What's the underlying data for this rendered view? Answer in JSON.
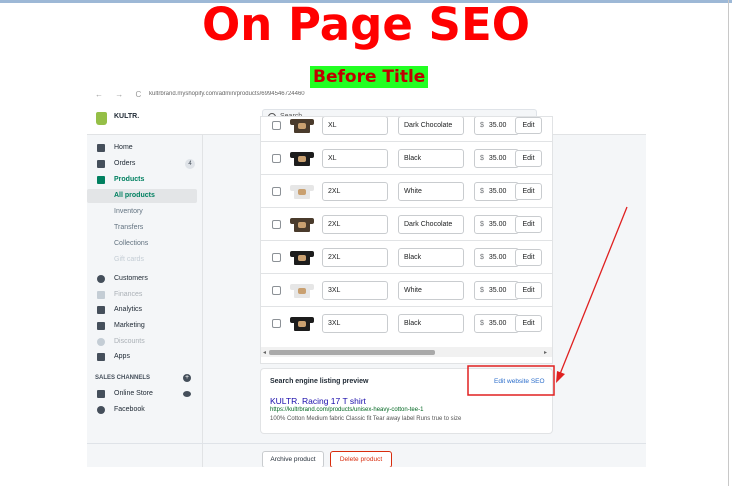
{
  "slide": {
    "title": "On Page SEO",
    "badge": "Before Title"
  },
  "browser": {
    "nav_glyphs": "← → C",
    "url": "kultrbrand.myshopify.com/admin/products/6994546724460"
  },
  "topbar": {
    "brand": "KULTR.",
    "search_placeholder": "Search"
  },
  "sidebar": {
    "items": [
      {
        "label": "Home",
        "icon": "home-icon"
      },
      {
        "label": "Orders",
        "icon": "orders-icon",
        "badge": "4"
      },
      {
        "label": "Products",
        "icon": "tag-icon"
      },
      {
        "label": "All products"
      },
      {
        "label": "Inventory"
      },
      {
        "label": "Transfers"
      },
      {
        "label": "Collections"
      },
      {
        "label": "Gift cards"
      },
      {
        "label": "Customers",
        "icon": "person-icon"
      },
      {
        "label": "Finances",
        "icon": "finances-icon"
      },
      {
        "label": "Analytics",
        "icon": "bar-chart-icon"
      },
      {
        "label": "Marketing",
        "icon": "megaphone-icon"
      },
      {
        "label": "Discounts",
        "icon": "discount-icon"
      },
      {
        "label": "Apps",
        "icon": "apps-icon"
      }
    ],
    "sales_channels_heading": "SALES CHANNELS",
    "channels": [
      {
        "label": "Online Store",
        "icon": "store-icon"
      },
      {
        "label": "Facebook",
        "icon": "facebook-icon"
      }
    ]
  },
  "variants": {
    "currency": "$",
    "edit_label": "Edit",
    "rows": [
      {
        "size": "XL",
        "color": "Dark Chocolate",
        "price": "35.00",
        "tee": "brown"
      },
      {
        "size": "XL",
        "color": "Black",
        "price": "35.00",
        "tee": "black"
      },
      {
        "size": "2XL",
        "color": "White",
        "price": "35.00",
        "tee": "white"
      },
      {
        "size": "2XL",
        "color": "Dark Chocolate",
        "price": "35.00",
        "tee": "brown"
      },
      {
        "size": "2XL",
        "color": "Black",
        "price": "35.00",
        "tee": "black"
      },
      {
        "size": "3XL",
        "color": "White",
        "price": "35.00",
        "tee": "white"
      },
      {
        "size": "3XL",
        "color": "Black",
        "price": "35.00",
        "tee": "black"
      }
    ]
  },
  "seo": {
    "heading": "Search engine listing preview",
    "edit_link": "Edit website SEO",
    "title": "KULTR. Racing 17 T shirt",
    "url": "https://kultrbrand.com/products/unisex-heavy-cotton-tee-1",
    "description": "100% Cotton Medium fabric Classic fit Tear away label Runs true to size"
  },
  "footer": {
    "archive_label": "Archive product",
    "delete_label": "Delete product"
  },
  "colors": {
    "annotation_red": "#e02020",
    "shopify_green": "#008060",
    "link_blue": "#2c6ecb"
  }
}
